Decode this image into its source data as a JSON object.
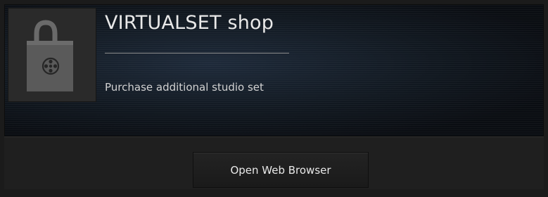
{
  "shop": {
    "title": "VIRTUALSET shop",
    "subtitle": "Purchase additional studio set",
    "icon": "shopping-bag-film-reel-icon"
  },
  "actions": {
    "open_browser_label": "Open Web Browser"
  },
  "colors": {
    "background": "#1b1b1b",
    "header_dark": "#0b0e13",
    "header_glow": "#1e2a3a",
    "icon_tile": "#2a2a2a",
    "text_primary": "#e9e9e9"
  }
}
